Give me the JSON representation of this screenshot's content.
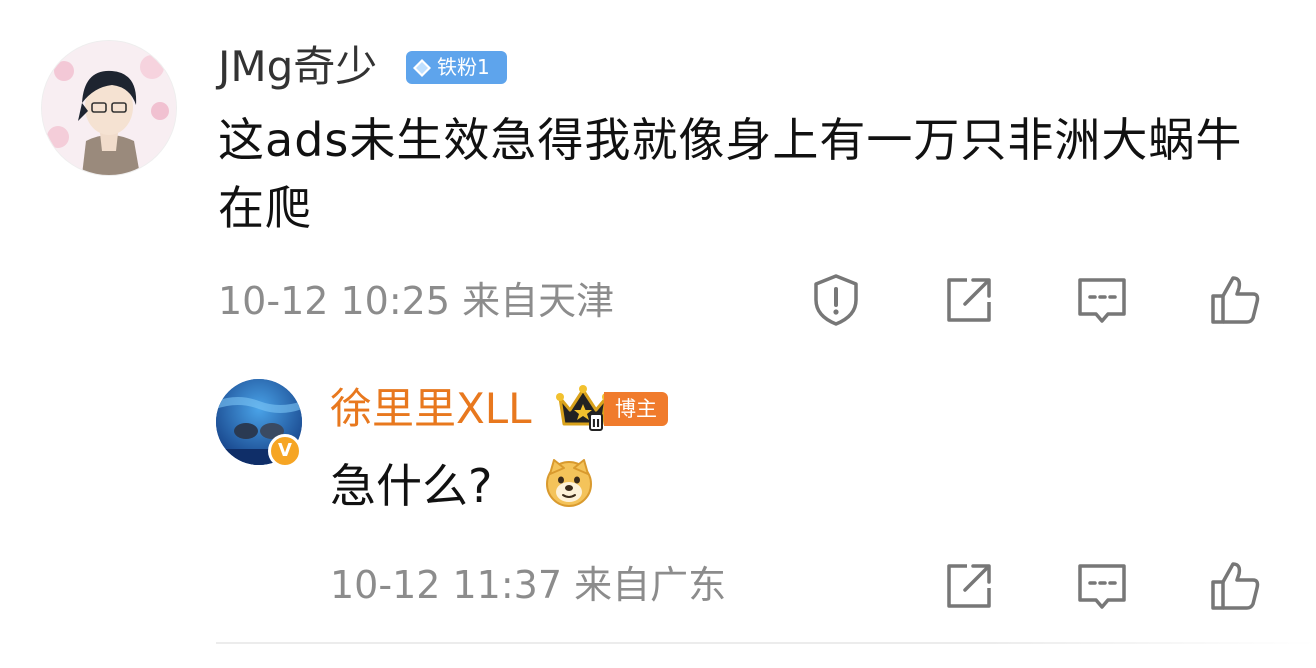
{
  "comment": {
    "username": "JMg奇少",
    "fan_badge": "铁粉1",
    "text": "这ads未生效急得我就像身上有一万只非洲大蜗牛在爬",
    "meta": "10-12 10:25  来自天津",
    "actions": [
      "report-icon",
      "repost-icon",
      "comment-icon",
      "like-icon"
    ]
  },
  "reply": {
    "username": "徐里里XLL",
    "crown_level": "II",
    "host_badge": "博主",
    "verified_mark": "V",
    "text": "急什么?",
    "emoji": "doge-icon",
    "meta": "10-12 11:37  来自广东",
    "actions": [
      "repost-icon",
      "comment-icon",
      "like-icon"
    ]
  },
  "colors": {
    "reply_name": "#e8781e",
    "fan_badge": "#5ea4ec",
    "host_badge": "#f07b2c",
    "meta_text": "#8c8c8c"
  }
}
